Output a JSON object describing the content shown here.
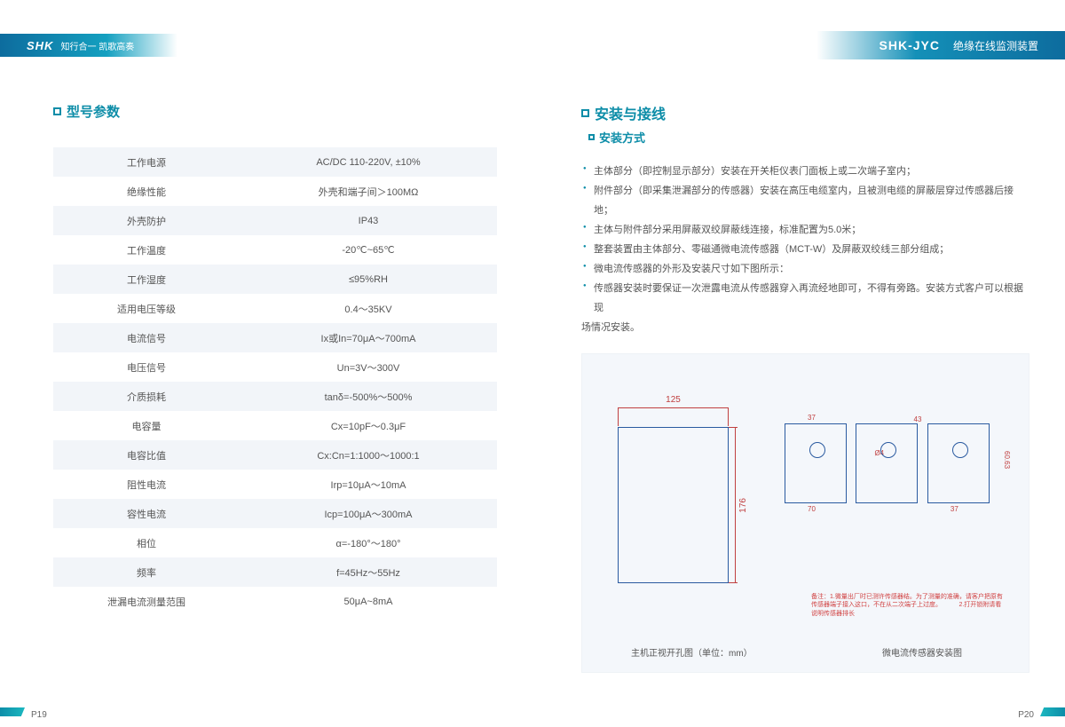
{
  "header": {
    "left_logo": "SHK",
    "left_slogan": "知行合一 凯歌高奏",
    "right_code": "SHK-JYC",
    "right_name": "绝缘在线监测装置"
  },
  "left": {
    "title": "型号参数",
    "specs": [
      {
        "label": "工作电源",
        "value": "AC/DC 110-220V, ±10%"
      },
      {
        "label": "绝缘性能",
        "value": "外壳和端子间＞100MΩ"
      },
      {
        "label": "外壳防护",
        "value": "IP43"
      },
      {
        "label": "工作温度",
        "value": "-20℃~65℃"
      },
      {
        "label": "工作湿度",
        "value": "≤95%RH"
      },
      {
        "label": "适用电压等级",
        "value": "0.4～35KV"
      },
      {
        "label": "电流信号",
        "value": "Ix或In=70μA～700mA"
      },
      {
        "label": "电压信号",
        "value": "Un=3V～300V"
      },
      {
        "label": "介质损耗",
        "value": "tanδ=-500%～500%"
      },
      {
        "label": "电容量",
        "value": "Cx=10pF～0.3μF"
      },
      {
        "label": "电容比值",
        "value": "Cx:Cn=1:1000～1000:1"
      },
      {
        "label": "阻性电流",
        "value": "Irp=10μA～10mA"
      },
      {
        "label": "容性电流",
        "value": "Icp=100μA～300mA"
      },
      {
        "label": "相位",
        "value": "α=-180°～180°"
      },
      {
        "label": "频率",
        "value": "f=45Hz～55Hz"
      },
      {
        "label": "泄漏电流测量范围",
        "value": "50μA~8mA"
      }
    ]
  },
  "right": {
    "title": "安装与接线",
    "subtitle": "安装方式",
    "bullets": [
      "主体部分（即控制显示部分）安装在开关柜仪表门面板上或二次端子室内；",
      "附件部分（即采集泄漏部分的传感器）安装在高压电缆室内，且被测电缆的屏蔽层穿过传感器后接地；",
      "主体与附件部分采用屏蔽双绞屏蔽线连接，标准配置为5.0米；",
      "整套装置由主体部分、零磁通微电流传感器（MCT-W）及屏蔽双绞线三部分组成；",
      "微电流传感器的外形及安装尺寸如下图所示：",
      "传感器安装时要保证一次泄露电流从传感器穿入再流经地即可，不得有旁路。安装方式客户可以根据现"
    ],
    "bullet_wrap": "场情况安装。",
    "diagram": {
      "host_width": "125",
      "host_height": "176",
      "sensor_dims": {
        "w1": "70",
        "h1": "37",
        "w2": "37",
        "h2": "60.63",
        "d": "Ø4",
        "a": "43"
      },
      "warning": "备注：1.微量出厂时已测许传感器结。为了测量的准确，请客户把原有传感器端子接入这口，不在从二次端子上过度。\n         2.打开锁附请看说明传感器排长",
      "caption_left": "主机正视开孔图（单位：mm）",
      "caption_right": "微电流传感器安装图"
    }
  },
  "footer": {
    "left_page": "P19",
    "right_page": "P20"
  }
}
